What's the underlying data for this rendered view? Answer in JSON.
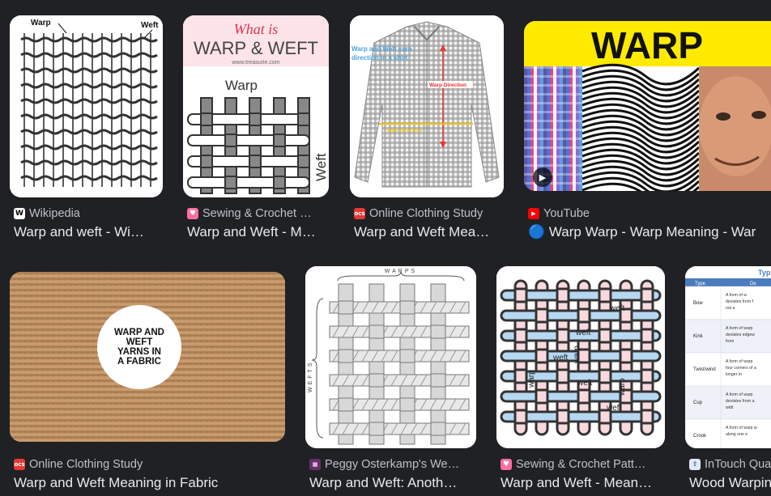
{
  "results": [
    {
      "source": "Wikipedia",
      "title": "Warp and weft - Wi…",
      "favicon": "wikipedia-icon",
      "favicon_text": "W",
      "labels": {
        "warp": "Warp",
        "weft": "Weft"
      }
    },
    {
      "source": "Sewing & Crochet …",
      "title": "Warp and Weft - M…",
      "favicon": "heart-icon",
      "labels": {
        "what_is": "What is",
        "headline": "WARP & WEFT",
        "site": "www.treasurie.com",
        "warp": "Warp",
        "weft": "Weft"
      }
    },
    {
      "source": "Online Clothing Study",
      "title": "Warp and Weft Mea…",
      "favicon": "ocs-icon",
      "favicon_text": "ocs",
      "labels": {
        "note": "Warp and Weft yarn direction in a shirt",
        "warp_dir": "Warp Direction",
        "weft_dir": "Weft direction"
      }
    },
    {
      "source": "YouTube",
      "title": "🔵 Warp Warp - Warp Meaning - War",
      "favicon": "youtube-icon",
      "labels": {
        "headline": "WARP"
      }
    },
    {
      "source": "Online Clothing Study",
      "title": "Warp and Weft Meaning in Fabric",
      "favicon": "ocs-icon",
      "favicon_text": "ocs",
      "labels": {
        "badge": "WARP AND WEFT YARNS IN A FABRIC"
      }
    },
    {
      "source": "Peggy Osterkamp's We…",
      "title": "Warp and Weft: Anoth…",
      "favicon": "weaving-icon",
      "labels": {
        "warps": "WARPS",
        "wefts": "WEFTS"
      }
    },
    {
      "source": "Sewing & Crochet Patt…",
      "title": "Warp and Weft - Mean…",
      "favicon": "heart-icon",
      "labels": {
        "warp": "warp",
        "weft": "weft"
      }
    },
    {
      "source": "InTouch Qua",
      "title": "Wood Warpin",
      "favicon": "intouch-icon",
      "labels": {
        "header": "Typ",
        "col_type": "Type",
        "col_def": "De",
        "rows": [
          "Bow",
          "Kink",
          "Twist/wind",
          "Cup",
          "Crook"
        ],
        "descs": [
          "A form of w deviates from f not a",
          "A form of warp deviates edgew from",
          "A form of warp four corners of a longer in",
          "A form of warp deviates from a widt",
          "A form of warp w along one e"
        ]
      }
    }
  ]
}
